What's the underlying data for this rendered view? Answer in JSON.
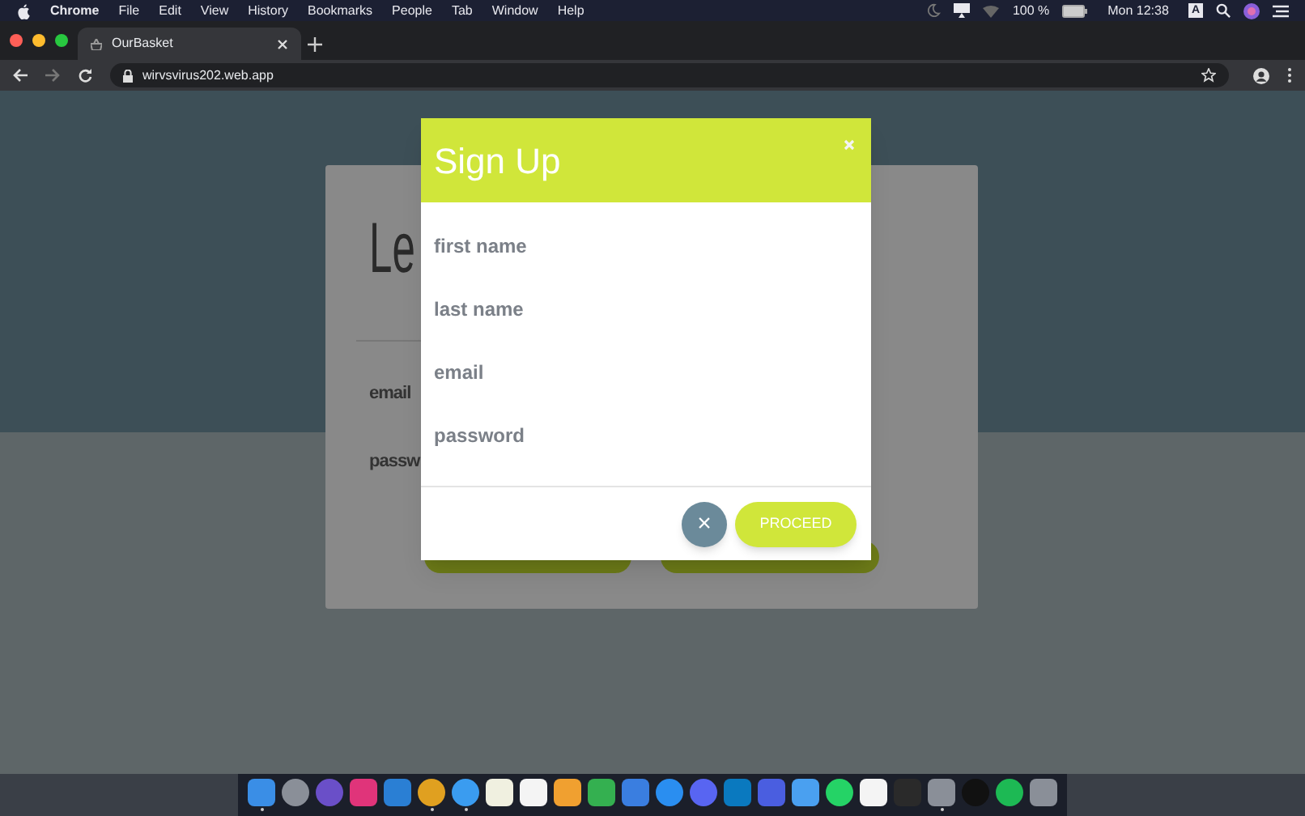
{
  "menu_bar": {
    "app": "Chrome",
    "items": [
      "File",
      "Edit",
      "View",
      "History",
      "Bookmarks",
      "People",
      "Tab",
      "Window",
      "Help"
    ],
    "battery": "100 %",
    "clock": "Mon 12:38",
    "input_source": "A"
  },
  "browser": {
    "tabs": [
      {
        "title": "OurBasket",
        "selected": true
      }
    ],
    "url": "wirvsvirus202.web.app"
  },
  "login_card": {
    "heading": "Le",
    "fields": [
      "email",
      "passw"
    ]
  },
  "dialog": {
    "title": "Sign Up",
    "fields": [
      {
        "placeholder": "first name"
      },
      {
        "placeholder": "last name"
      },
      {
        "placeholder": "email"
      },
      {
        "placeholder": "password"
      }
    ],
    "cancel_icon": "×",
    "proceed": "PROCEED"
  },
  "dock": [
    {
      "kind": "finder",
      "running": true
    },
    {
      "kind": "rocket",
      "running": false
    },
    {
      "kind": "siri",
      "running": false
    },
    {
      "kind": "cube",
      "running": false
    },
    {
      "kind": "code",
      "running": false
    },
    {
      "kind": "chrome",
      "running": true
    },
    {
      "kind": "compass",
      "running": true
    },
    {
      "kind": "notes",
      "running": false
    },
    {
      "kind": "calendar",
      "running": false
    },
    {
      "kind": "pages",
      "running": false
    },
    {
      "kind": "numbers",
      "running": false
    },
    {
      "kind": "keynote",
      "running": false
    },
    {
      "kind": "store",
      "running": false
    },
    {
      "kind": "chat",
      "running": false
    },
    {
      "kind": "board",
      "running": false
    },
    {
      "kind": "pen",
      "running": false
    },
    {
      "kind": "bubble",
      "running": false
    },
    {
      "kind": "phone",
      "running": false
    },
    {
      "kind": "slack",
      "running": false
    },
    {
      "kind": "terminal",
      "running": false
    },
    {
      "kind": "gear",
      "running": true
    },
    {
      "kind": "tv",
      "running": false
    },
    {
      "kind": "music",
      "running": false
    },
    {
      "kind": "trash",
      "running": false
    }
  ]
}
